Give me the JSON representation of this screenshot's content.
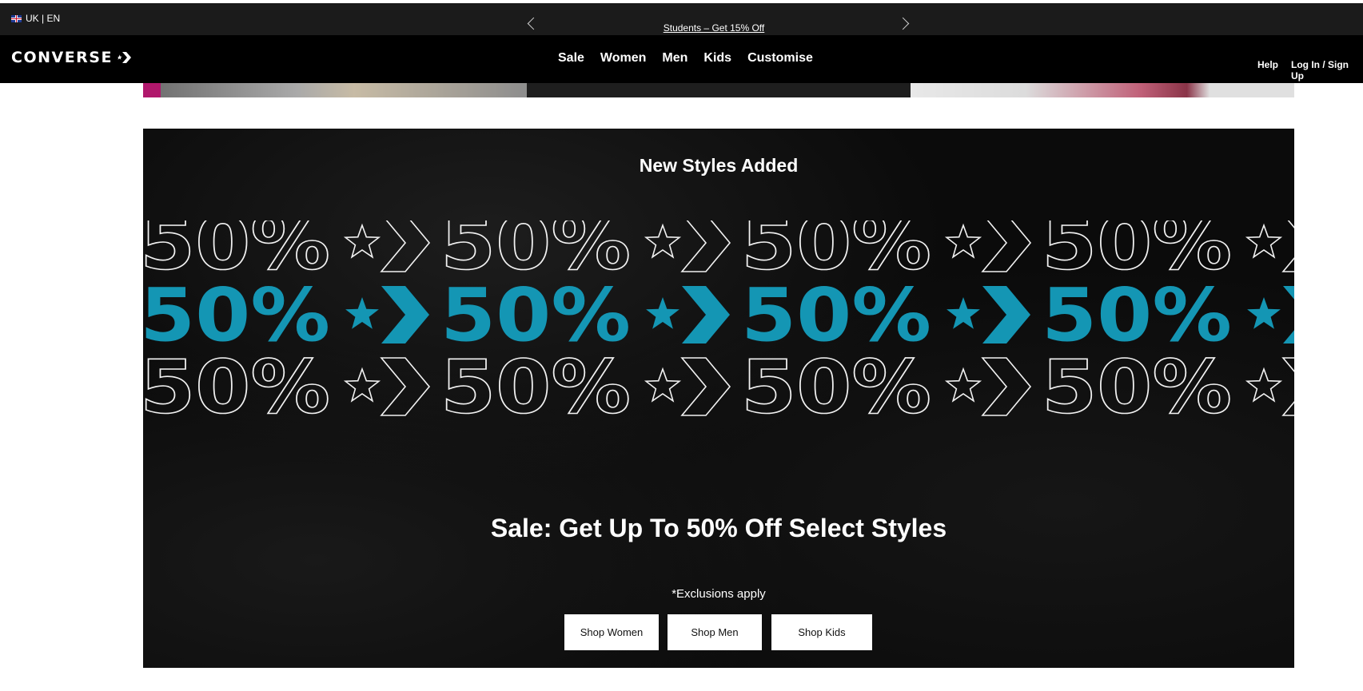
{
  "locale": {
    "label": "UK | EN",
    "flag_icon": "uk-flag-icon"
  },
  "promo": {
    "text": "Students – Get 15% Off",
    "prev_icon": "chevron-left-icon",
    "next_icon": "chevron-right-icon"
  },
  "header": {
    "logo_text": "CONVERSE",
    "logo_icon": "star-chevron-icon",
    "nav": [
      "Sale",
      "Women",
      "Men",
      "Kids",
      "Customise"
    ],
    "help": "Help",
    "login": "Log In / Sign Up"
  },
  "hero": {
    "eyebrow": "New Styles Added",
    "marquee_text": "50%",
    "marquee_rows": [
      "outline",
      "filled",
      "outline"
    ],
    "accent_color": "#1496b4",
    "title": "Sale: Get Up To 50% Off Select Styles",
    "note": "*Exclusions apply",
    "buttons": [
      "Shop Women",
      "Shop Men",
      "Shop Kids"
    ]
  },
  "colors": {
    "topbar": "#1b1b1b",
    "navbar": "#000000",
    "hero_bg": "#0b0b0b",
    "accent": "#1496b4"
  }
}
